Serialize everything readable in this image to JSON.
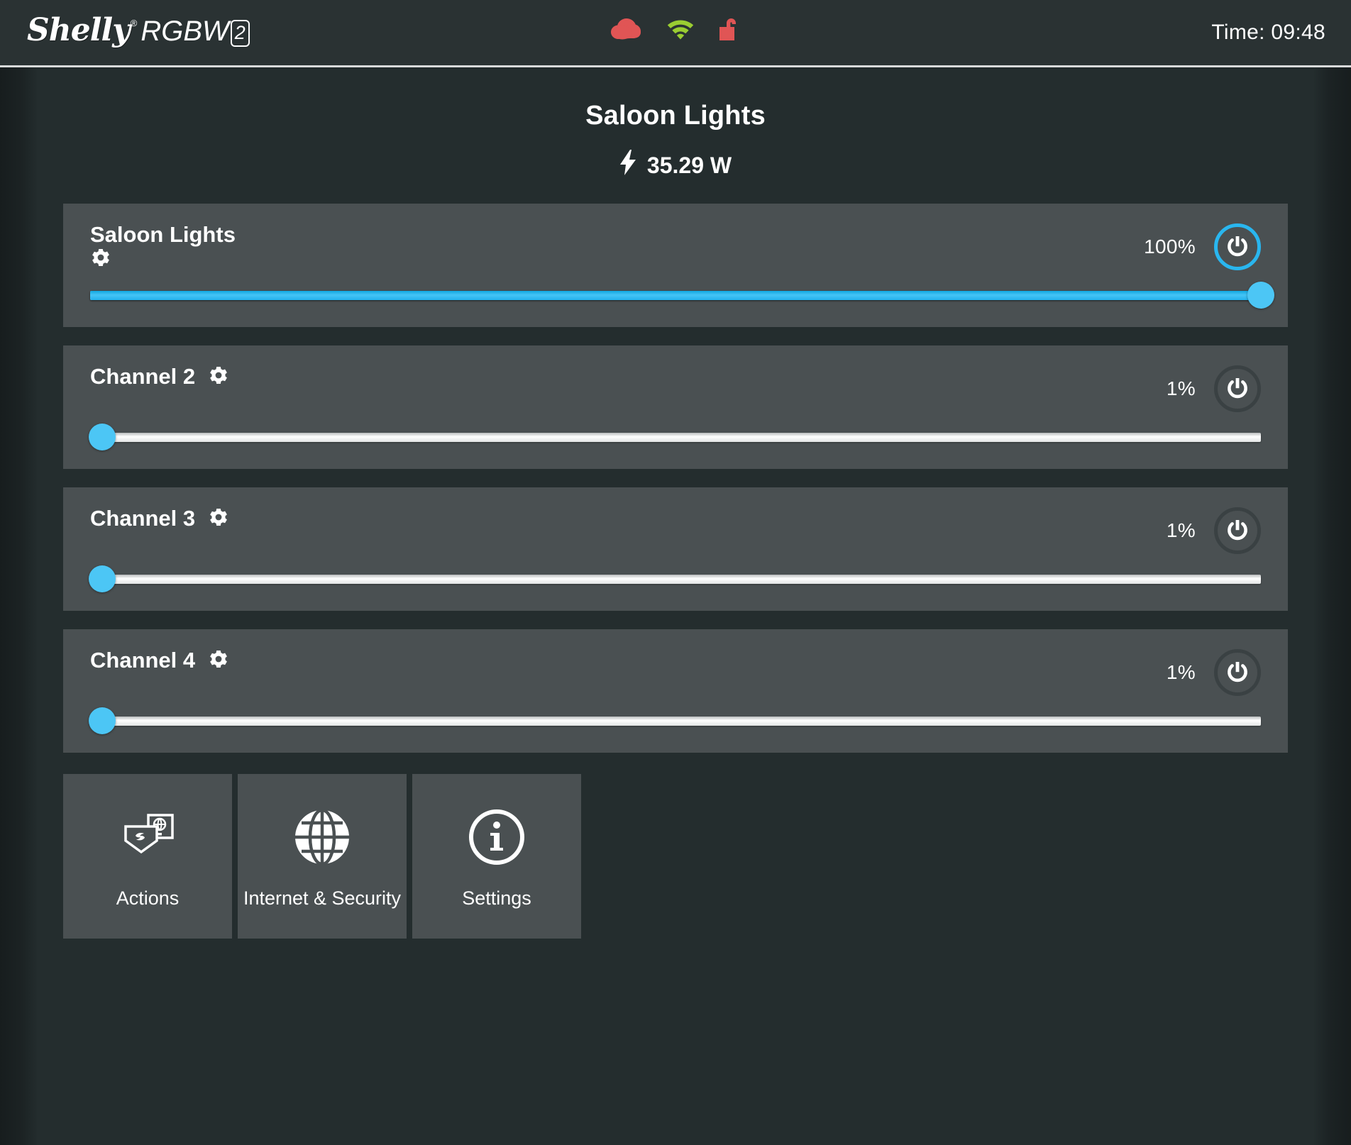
{
  "header": {
    "logo_brand": "Shelly",
    "logo_reg": "®",
    "logo_model": "RGBW",
    "logo_model_number": "2",
    "status": {
      "cloud": {
        "icon": "cloud-icon",
        "color": "#e05555",
        "state": "disconnected"
      },
      "wifi": {
        "icon": "wifi-icon",
        "color": "#9acd32",
        "state": "connected"
      },
      "lock": {
        "icon": "unlock-icon",
        "color": "#e05555",
        "state": "unlocked"
      }
    },
    "time_label": "Time: 09:48"
  },
  "main": {
    "title": "Saloon Lights",
    "power_reading": "35.29 W",
    "power_icon": "bolt-icon",
    "accent_color": "#29b6ef",
    "track_color": "#ffffff",
    "card_color": "#4a5052"
  },
  "channels": [
    {
      "name": "Saloon Lights",
      "percent_label": "100%",
      "percent_value": 100,
      "on": true,
      "gear_icon": "gear-icon",
      "power_icon": "power-icon",
      "gear_wraps": true
    },
    {
      "name": "Channel 2",
      "percent_label": "1%",
      "percent_value": 1,
      "on": false,
      "gear_icon": "gear-icon",
      "power_icon": "power-icon",
      "gear_wraps": false
    },
    {
      "name": "Channel 3",
      "percent_label": "1%",
      "percent_value": 1,
      "on": false,
      "gear_icon": "gear-icon",
      "power_icon": "power-icon",
      "gear_wraps": false
    },
    {
      "name": "Channel 4",
      "percent_label": "1%",
      "percent_value": 1,
      "on": false,
      "gear_icon": "gear-icon",
      "power_icon": "power-icon",
      "gear_wraps": false
    }
  ],
  "nav": [
    {
      "label": "Actions",
      "icon": "shelly-shield-browser-icon"
    },
    {
      "label": "Internet & Security",
      "icon": "globe-icon"
    },
    {
      "label": "Settings",
      "icon": "info-circle-icon"
    }
  ]
}
